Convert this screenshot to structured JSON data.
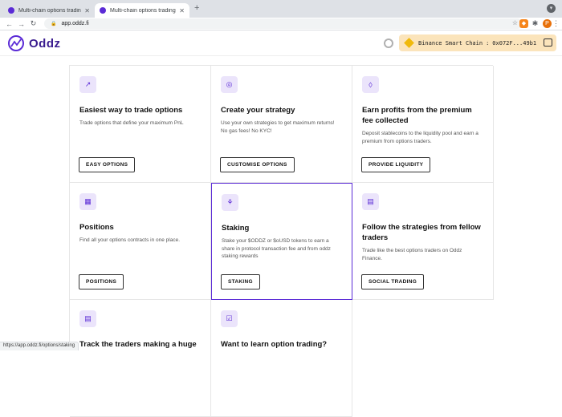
{
  "browser": {
    "tabs": [
      {
        "label": "Multi-chain options trading"
      },
      {
        "label": "Multi-chain options trading"
      }
    ],
    "url": "app.oddz.fi",
    "status_url": "https://app.oddz.fi/options/staking"
  },
  "header": {
    "brand": "Oddz",
    "network": "Binance Smart Chain",
    "separator": ":",
    "address": "0x072F...49b1"
  },
  "cards": [
    {
      "title": "Easiest way to trade options",
      "desc": "Trade options that define your maximum PnL",
      "button": "EASY OPTIONS",
      "icon": "trend-icon"
    },
    {
      "title": "Create your strategy",
      "desc": "Use your own strategies to get maximum returns! No gas fees! No KYC!",
      "button": "CUSTOMISE OPTIONS",
      "icon": "target-icon"
    },
    {
      "title": "Earn profits from the premium fee collected",
      "desc": "Deposit stablecoins to the liquidity pool and earn a premium from options traders.",
      "button": "PROVIDE LIQUIDITY",
      "icon": "drop-icon"
    },
    {
      "title": "Positions",
      "desc": "Find all your options contracts in one place.",
      "button": "POSITIONS",
      "icon": "grid-icon"
    },
    {
      "title": "Staking",
      "desc": "Stake your $ODDZ or $oUSD tokens to earn a share in protocol transaction fee and from oddz staking rewards",
      "button": "STAKING",
      "icon": "stake-icon"
    },
    {
      "title": "Follow the strategies from fellow traders",
      "desc": "Trade like the best options traders on Oddz Finance.",
      "button": "SOCIAL TRADING",
      "icon": "layout-icon"
    },
    {
      "title": "Track the traders making a huge",
      "desc": "",
      "button": "",
      "icon": "layout-icon"
    },
    {
      "title": "Want to learn option trading?",
      "desc": "",
      "button": "",
      "icon": "check-icon"
    }
  ]
}
